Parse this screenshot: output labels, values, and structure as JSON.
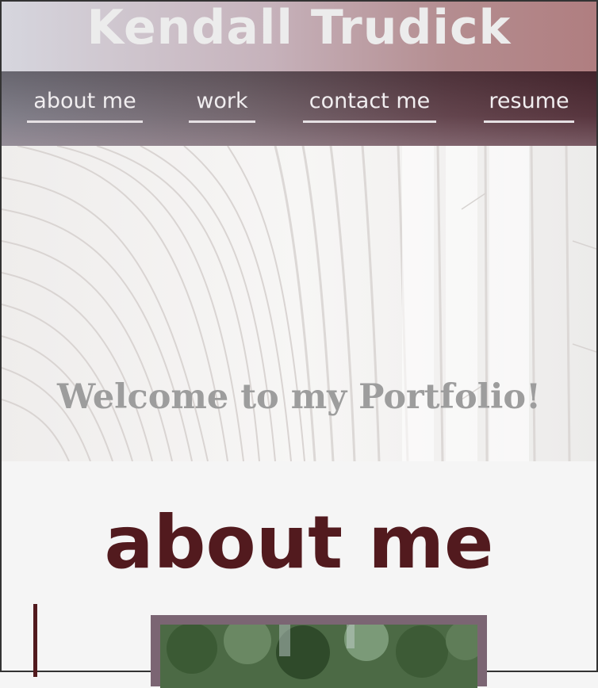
{
  "header": {
    "site_title": "Kendall Trudick"
  },
  "nav": {
    "items": [
      {
        "label": "about me"
      },
      {
        "label": "work"
      },
      {
        "label": "contact me"
      },
      {
        "label": "resume"
      }
    ]
  },
  "hero": {
    "welcome_text": "Welcome to my Portfolio!"
  },
  "about": {
    "heading": "about me"
  },
  "colors": {
    "accent": "#521a1e",
    "photo_frame": "#7b6573",
    "nav_text": "#f1eef0"
  }
}
